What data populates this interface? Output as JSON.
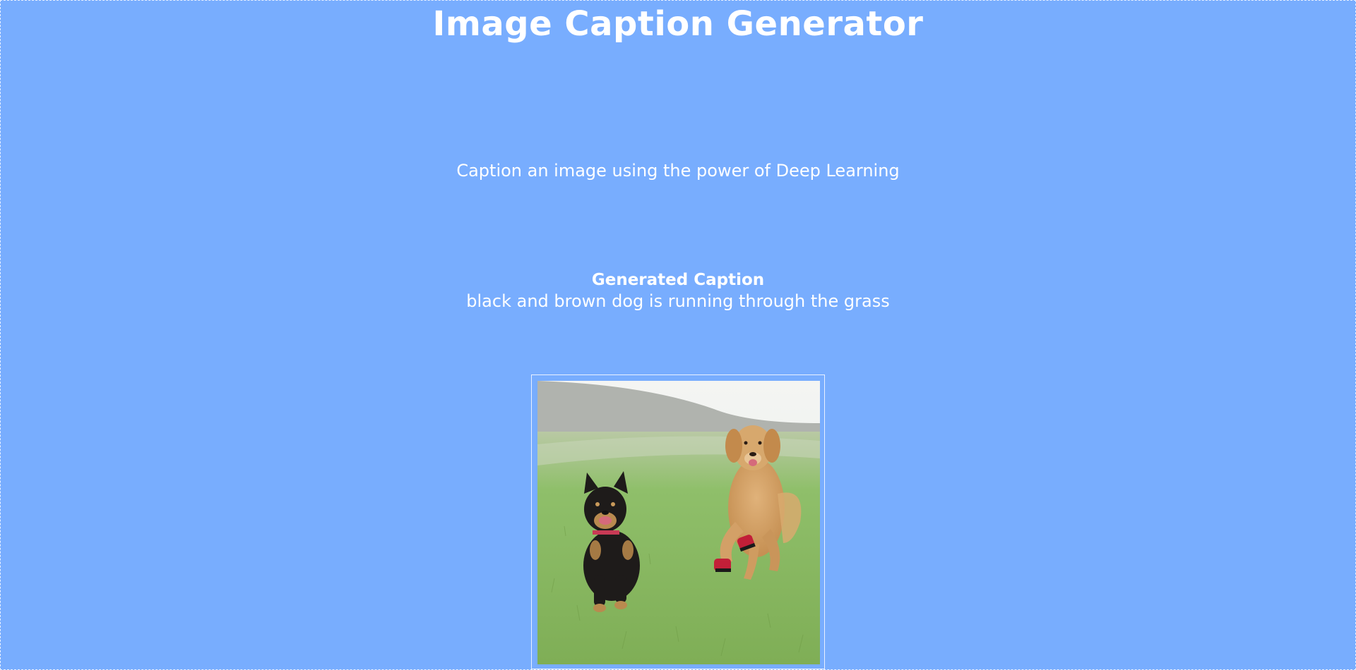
{
  "header": {
    "title": "Image Caption Generator"
  },
  "intro": {
    "subtitle": "Caption an image using the power of Deep Learning"
  },
  "result": {
    "heading": "Generated Caption",
    "caption": "black and brown dog is running through the grass"
  },
  "colors": {
    "background": "#78adfe",
    "text": "#ffffff"
  }
}
